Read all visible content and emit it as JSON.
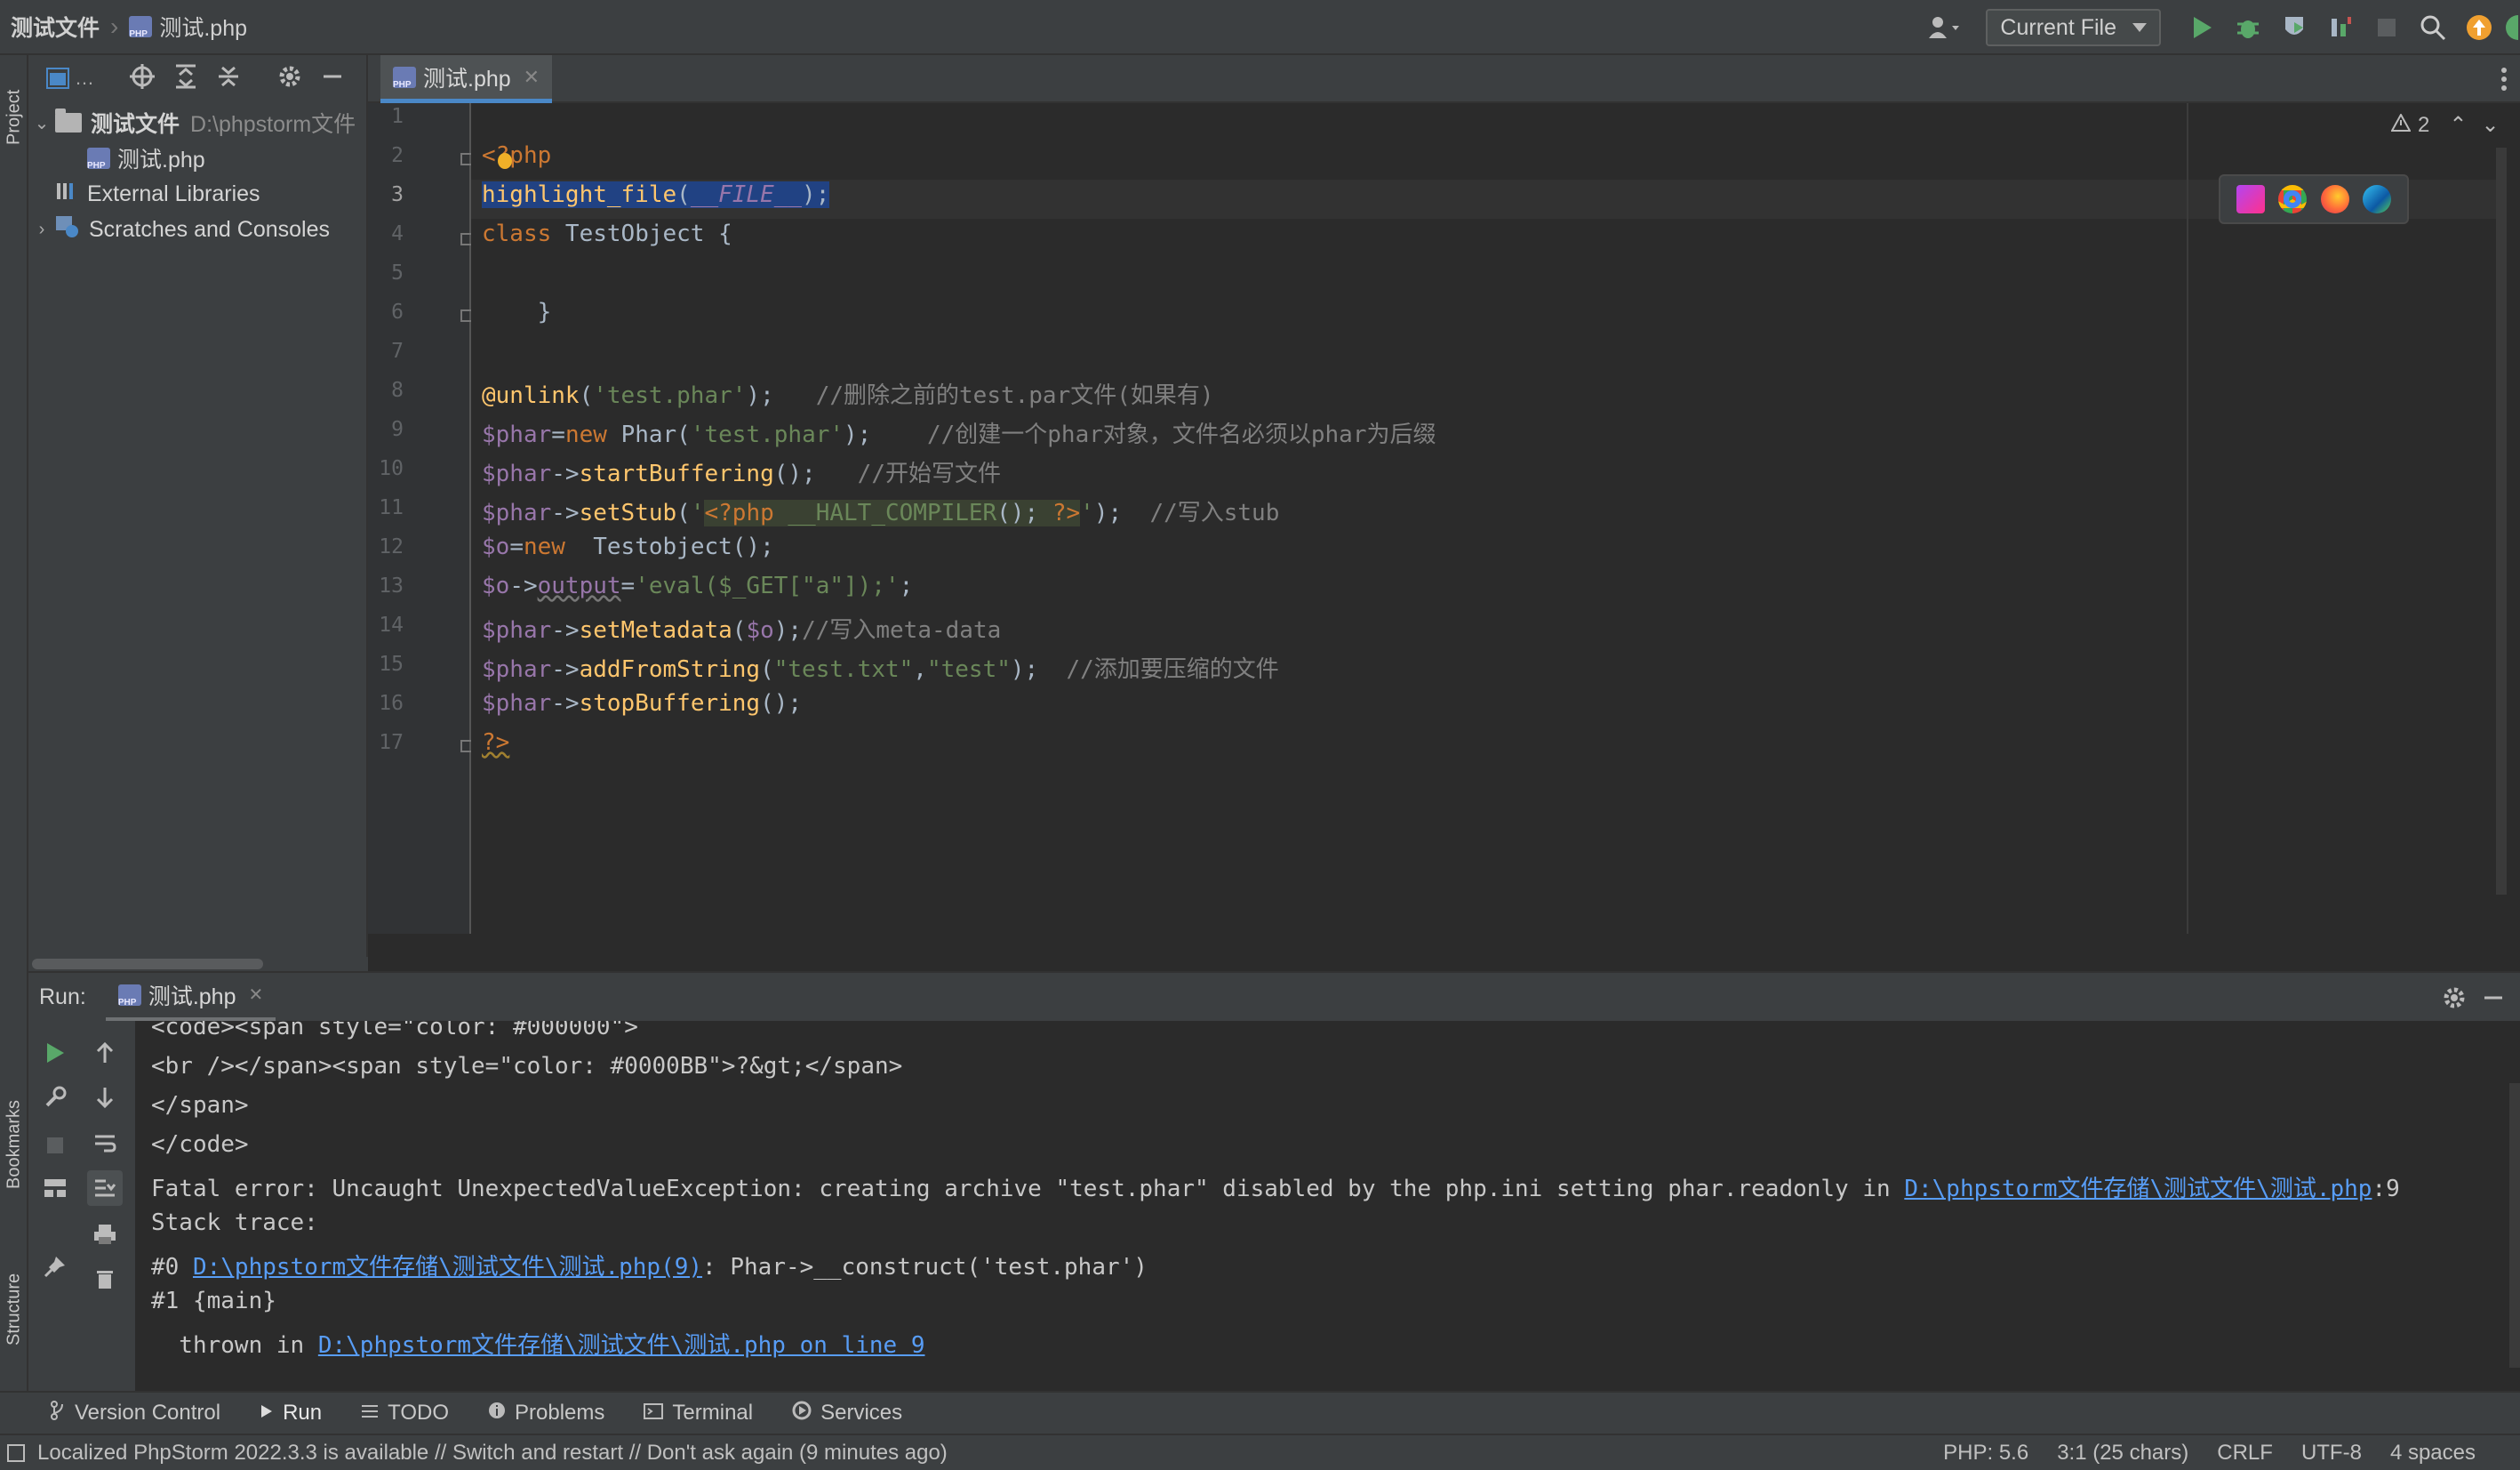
{
  "breadcrumb": {
    "project": "测试文件",
    "file": "测试.php"
  },
  "toolbar": {
    "run_config": "Current File"
  },
  "project_panel": {
    "tab_label": "Project",
    "toolbar_more": "…",
    "root_name": "测试文件",
    "root_path": "D:\\phpstorm文件",
    "file_name": "测试.php",
    "external_libraries": "External Libraries",
    "scratches": "Scratches and Consoles"
  },
  "editor": {
    "tab_label": "测试.php",
    "warnings_count": "2",
    "line_numbers": [
      "1",
      "2",
      "3",
      "4",
      "5",
      "6",
      "7",
      "8",
      "9",
      "10",
      "11",
      "12",
      "13",
      "14",
      "15",
      "16",
      "17"
    ]
  },
  "run_panel": {
    "label": "Run:",
    "tab": "测试.php",
    "console": {
      "l1": "<code><span style=\"color: #000000\">",
      "l2": "<br /></span><span style=\"color: #0000BB\">?&gt;</span>",
      "l3": "</span>",
      "l4": "</code>",
      "l5_pre": "Fatal error: Uncaught UnexpectedValueException: creating archive \"test.phar\" disabled by the php.ini setting phar.readonly in ",
      "l5_link": "D:\\phpstorm文件存储\\测试文件\\测试.php",
      "l5_post": ":9",
      "l6": "Stack trace:",
      "l7_pre": "#0 ",
      "l7_link": "D:\\phpstorm文件存储\\测试文件\\测试.php(9)",
      "l7_post": ": Phar->__construct('test.phar')",
      "l8": "#1 {main}",
      "l9_pre": "  thrown in ",
      "l9_link": "D:\\phpstorm文件存储\\测试文件\\测试.php on line 9"
    }
  },
  "side_tabs": {
    "bookmarks": "Bookmarks",
    "structure": "Structure"
  },
  "bottom_tabs": [
    "Version Control",
    "Run",
    "TODO",
    "Problems",
    "Terminal",
    "Services"
  ],
  "status": {
    "message": "Localized PhpStorm 2022.3.3 is available // Switch and restart // Don't ask again (9 minutes ago)",
    "php": "PHP: 5.6",
    "position": "3:1 (25 chars)",
    "line_sep": "CRLF",
    "encoding": "UTF-8",
    "indent": "4 spaces"
  },
  "colors": {
    "keyword": "#cc7832",
    "function": "#ffc66d",
    "string": "#6a8759",
    "comment": "#808080",
    "variable": "#9876aa",
    "link": "#589df6",
    "accent": "#4a88c7"
  }
}
